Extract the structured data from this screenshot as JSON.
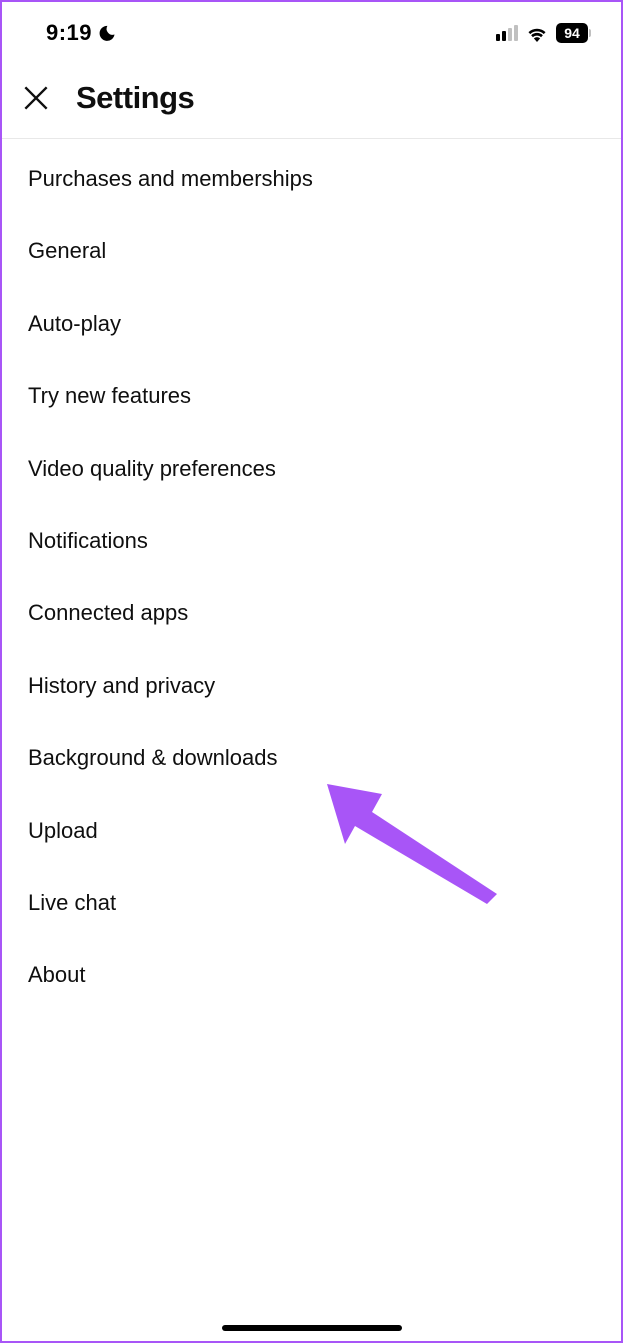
{
  "status_bar": {
    "time": "9:19",
    "battery_percent": "94"
  },
  "header": {
    "title": "Settings"
  },
  "settings": {
    "items": [
      {
        "label": "Purchases and memberships"
      },
      {
        "label": "General"
      },
      {
        "label": "Auto-play"
      },
      {
        "label": "Try new features"
      },
      {
        "label": "Video quality preferences"
      },
      {
        "label": "Notifications"
      },
      {
        "label": "Connected apps"
      },
      {
        "label": "History and privacy"
      },
      {
        "label": "Background & downloads"
      },
      {
        "label": "Upload"
      },
      {
        "label": "Live chat"
      },
      {
        "label": "About"
      }
    ]
  },
  "annotation": {
    "arrow_color": "#a855f7"
  }
}
